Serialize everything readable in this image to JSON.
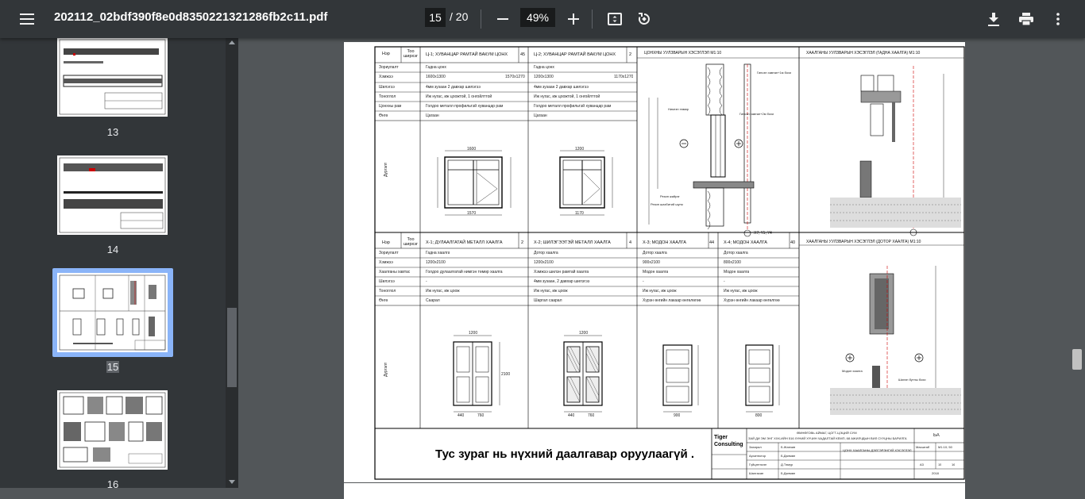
{
  "toolbar": {
    "filename": "202112_02bdf390f8e0d8350221321286fb2c11.pdf",
    "page_current": "15",
    "page_total": "/ 20",
    "zoom": "49%",
    "icons": [
      "menu-icon",
      "minus-icon",
      "plus-icon",
      "fit-page-icon",
      "rotate-icon",
      "download-icon",
      "print-icon",
      "more-vert-icon"
    ]
  },
  "sidebar": {
    "thumbnails": [
      {
        "label": "13"
      },
      {
        "label": "14"
      },
      {
        "label": "15",
        "selected": true
      },
      {
        "label": "16"
      }
    ]
  },
  "document": {
    "window_table_header": {
      "num": "Нэр",
      "qty": "Тоо ширхэг",
      "col1_title": "Ц-1; ХУВАНЦАР РАМТАЙ ВАКУМ ЦОНХ",
      "col1_qty": "45",
      "col2_title": "Ц-2; ХУВАНЦАР РАМТАЙ ВАКУМ ЦОНХ",
      "col2_qty": "2"
    },
    "window_rows": [
      {
        "label": "Зориулалт",
        "c1": "Гадна цонх",
        "c2": "Гадна цонх"
      },
      {
        "label": "Хэмжээ",
        "c1": "1600x1300",
        "c1b": "1570x1270",
        "c2": "1200x1300",
        "c2b": "1170x1270"
      },
      {
        "label": "Шилэгээ",
        "c1": "4мм зузаан 2 давхар шилэгээ",
        "c2": "4мм зузаан 2 давхар шилэгээ"
      },
      {
        "label": "Тоноглол",
        "c1": "Иж нугас, иж цоожтой, 1 онгойлттой",
        "c2": "Иж нугас, иж цоожтой, 1 онгойлттой"
      },
      {
        "label": "Цонхны рам",
        "c1": "Голдоо металл профильтэй хуванцар рам",
        "c2": "Голдоо металл профильтэй хуванцар рам"
      },
      {
        "label": "Өнгө",
        "c1": "Цагаан",
        "c2": "Цагаан"
      }
    ],
    "row_label_view": "Дүргэлт",
    "window_dims": {
      "w1": "1600",
      "w1b": "1570",
      "w2": "1200",
      "w2b": "1170"
    },
    "section1_title": "ЦОНХНЫ УУЛЗВАРЫН ХЭСЭГЛЭЛ М1:10",
    "section2_title": "ХААЛГАНЫ УУЛЗВАРЫН ХЭСЭГЛЭЛ (ГАДНА ХААЛГА) М1:10",
    "section3_title": "ХААЛГАНЫ УУЛЗВАРЫН ХЭСЭГЛЭЛ (ДОТОР ХААЛГА) М1:10",
    "section_labels": [
      "Гипсэн хавтан+1м бохи",
      "Гипсэн хавтан+2м бохи",
      "Нимгэн төмөр",
      "Резин жийрэг",
      "Резин шахбитий шугм",
      "Модон хаалга",
      "Шилэн бутны бохи"
    ],
    "axis_label": "Х7; Ү1; Ү4",
    "door_table_header": {
      "num": "Нэр",
      "qty": "Тоо ширхэг",
      "c1_title": "Х-1; ДУЛААЛГАТАЙ МЕТАЛЛ ХААЛГА",
      "c1_qty": "2",
      "c2_title": "Х-2; ШИЛЭГЭЭТЭЙ МЕТАЛЛ ХААЛГА",
      "c2_qty": "4",
      "c3_title": "Х-3; МОДОН ХААЛГА",
      "c3_qty": "44",
      "c4_title": "Х-4; МОДОН ХААЛГА",
      "c4_qty": "40"
    },
    "door_rows": [
      {
        "label": "Зориулалт",
        "c1": "Гадна хаалга",
        "c2": "Дотор хаалга",
        "c3": "Дотор хаалга",
        "c4": "Дотор хаалга"
      },
      {
        "label": "Хэмжээ",
        "c1": "1200x2100",
        "c2": "1200x2100",
        "c3": "900x2100",
        "c4": "800x2100"
      },
      {
        "label": "Хаалганы хавтас",
        "c1": "Голдоо дулаалгатай нимгэн төмөр хаалга",
        "c2": "Хэмжээ шилэн рамтай хаалга",
        "c3": "Модон хаалга",
        "c4": "Модон хаалга"
      },
      {
        "label": "Шилэгээ",
        "c1": "-",
        "c2": "4мм зузаан, 2 давхар шилэгээ",
        "c3": "-",
        "c4": "-"
      },
      {
        "label": "Тоноглол",
        "c1": "Иж нугас, иж цоож",
        "c2": "Иж нугас, иж цоож",
        "c3": "Иж нугас, иж цоож",
        "c4": "Иж нугас, иж цоож"
      },
      {
        "label": "Өнгө",
        "c1": "Саарал",
        "c2": "Шаргал саарал",
        "c3": "Хүрэн өнгийн лакаар өнгөлөгөө",
        "c4": "Хүрэн өнгийн лакаар өнгөлгөө"
      }
    ],
    "door_dims": {
      "d1w": "1200",
      "d2w": "1200",
      "h": "2100",
      "d1a": "440",
      "d1b": "760",
      "d2a": "440",
      "d2b": "760",
      "d3": "900",
      "d4": "800"
    },
    "notice": "Тус зураг нь нүхний даалгавар оруулаагүй .",
    "stamp": {
      "company": "Tiger Consulting",
      "project_line1": "ӨМНӨГОВЬ АЙМАГ, ЦОГТ-ЦЭЦИЙ СУМ",
      "project_line2": "ЗАЙ ДИ ЭМ ЭНГ ХХК-ИЙН 516 ХҮНИЙ ХҮЧИН ЧАДАЛТАЙ КЕМП, 68 АЖИЛЧДЫН ВИЛ СУУЦНЫ БАРИЛГА",
      "sheet_code": "БА",
      "roles": [
        "Захирал",
        "Архитектор",
        "Гүйцэтгэсэн",
        "Шалгасан"
      ],
      "names": [
        "Б.Жанчив",
        "Б.Дөлмөн",
        "Д.Тэмүр",
        "Б.Дөлмөн"
      ],
      "sheet_title": "ЦОНХ ХААЛГАНЫ ДЭЛГЭРЭНГҮЙ ХЭСЭГЛЭЛ",
      "scale_label": "Масштаб",
      "scale": "М1:10; 50",
      "size": "А3",
      "sheet_no": "15",
      "total": "16",
      "year": "2018"
    }
  }
}
